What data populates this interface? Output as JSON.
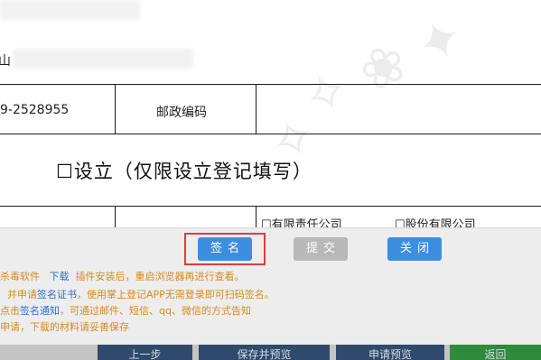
{
  "form": {
    "row1_partial_text": "山",
    "phone_partial": "9-2528955",
    "postal_code_label": "邮政编码",
    "section_title": "☐设立（仅限设立登记填写）",
    "checkbox_llc": "☐有限责任公司",
    "checkbox_joint_stock": "☐股份有限公司"
  },
  "actions": {
    "sign_label": "签名",
    "submit_label": "提交",
    "close_label": "关闭"
  },
  "notes": {
    "line1_a": "杀毒软件",
    "line1_link": "下载",
    "line1_b": "插件安装后，重启浏览器再进行查看。",
    "line2_a": "并申请",
    "line2_link": "签名证书",
    "line2_b": "，使用掌上登记APP无需登录即可扫码签名。",
    "line3_a": "点击",
    "line3_link": "签名通知",
    "line3_b": "，可通过邮件、短信、qq、微信的方式告知",
    "line4": "申请，下载的材料请妥善保存"
  },
  "nav": {
    "item1": "上一步",
    "item2": "保存并预览",
    "item3": "申请预览",
    "item4": "返回"
  },
  "colors": {
    "button_blue": "#3d8ee0",
    "button_gray": "#b8b8b8",
    "note_orange": "#d98a1a",
    "link_blue": "#2d6fd0",
    "highlight_red": "#e13b3b",
    "nav_dark": "#2f4a6c",
    "nav_green": "#2e8b3a"
  }
}
